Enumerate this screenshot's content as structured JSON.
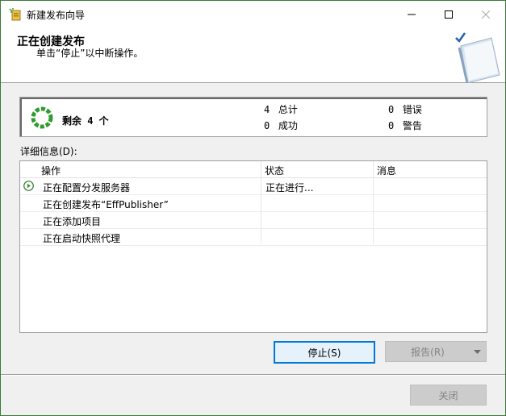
{
  "window": {
    "title": "新建发布向导",
    "minimize": "—",
    "maximize": "☐",
    "close": "✕"
  },
  "header": {
    "title": "正在创建发布",
    "subtitle": "单击“停止”以中断操作。"
  },
  "summary": {
    "remaining": "剩余 4 个",
    "total_num": "4",
    "total_label": "总计",
    "success_num": "0",
    "success_label": "成功",
    "error_num": "0",
    "error_label": "错误",
    "warning_num": "0",
    "warning_label": "警告"
  },
  "details": {
    "label": "详细信息(D):",
    "columns": [
      "操作",
      "状态",
      "消息"
    ],
    "rows": [
      {
        "action": "正在配置分发服务器",
        "status": "正在进行...",
        "message": ""
      },
      {
        "action": "正在创建发布“EffPublisher”",
        "status": "",
        "message": ""
      },
      {
        "action": "正在添加项目",
        "status": "",
        "message": ""
      },
      {
        "action": "正在启动快照代理",
        "status": "",
        "message": ""
      }
    ]
  },
  "buttons": {
    "stop": "停止(S)",
    "report": "报告(R)",
    "close": "关闭"
  },
  "colors": {
    "accent": "#0078d7",
    "progress_green": "#2e9b2e"
  }
}
